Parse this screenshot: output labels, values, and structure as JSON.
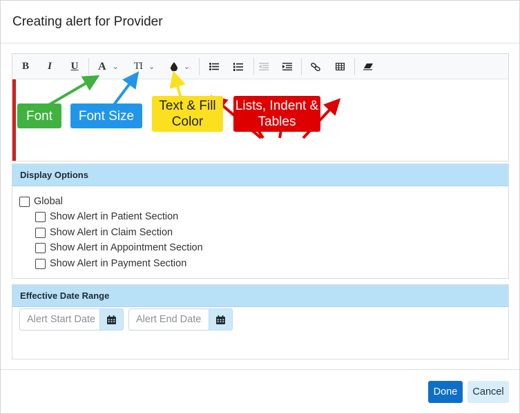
{
  "modal": {
    "title": "Creating alert for Provider"
  },
  "toolbar": {
    "bold": "B",
    "italic": "I",
    "underline": "U",
    "font": "A",
    "font_size": "TI"
  },
  "callouts": {
    "font": "Font",
    "font_size": "Font Size",
    "color": "Text & Fill Color",
    "lists": "Lists, Indent & Tables",
    "colors": {
      "font": "#3fb23f",
      "font_size": "#2196e9",
      "color": "#fbe020",
      "lists": "#de0000"
    }
  },
  "display_options": {
    "heading": "Display Options",
    "global": "Global",
    "items": [
      "Show Alert in Patient Section",
      "Show Alert in Claim Section",
      "Show Alert in Appointment Section",
      "Show Alert in Payment Section"
    ]
  },
  "date_range": {
    "heading": "Effective Date Range",
    "start_placeholder": "Alert Start Date",
    "end_placeholder": "Alert End Date"
  },
  "footer": {
    "done": "Done",
    "cancel": "Cancel"
  },
  "colors": {
    "accent": "#0f6fc6",
    "panel_header": "#b8e1f7",
    "editor_marker": "#d0211c"
  }
}
